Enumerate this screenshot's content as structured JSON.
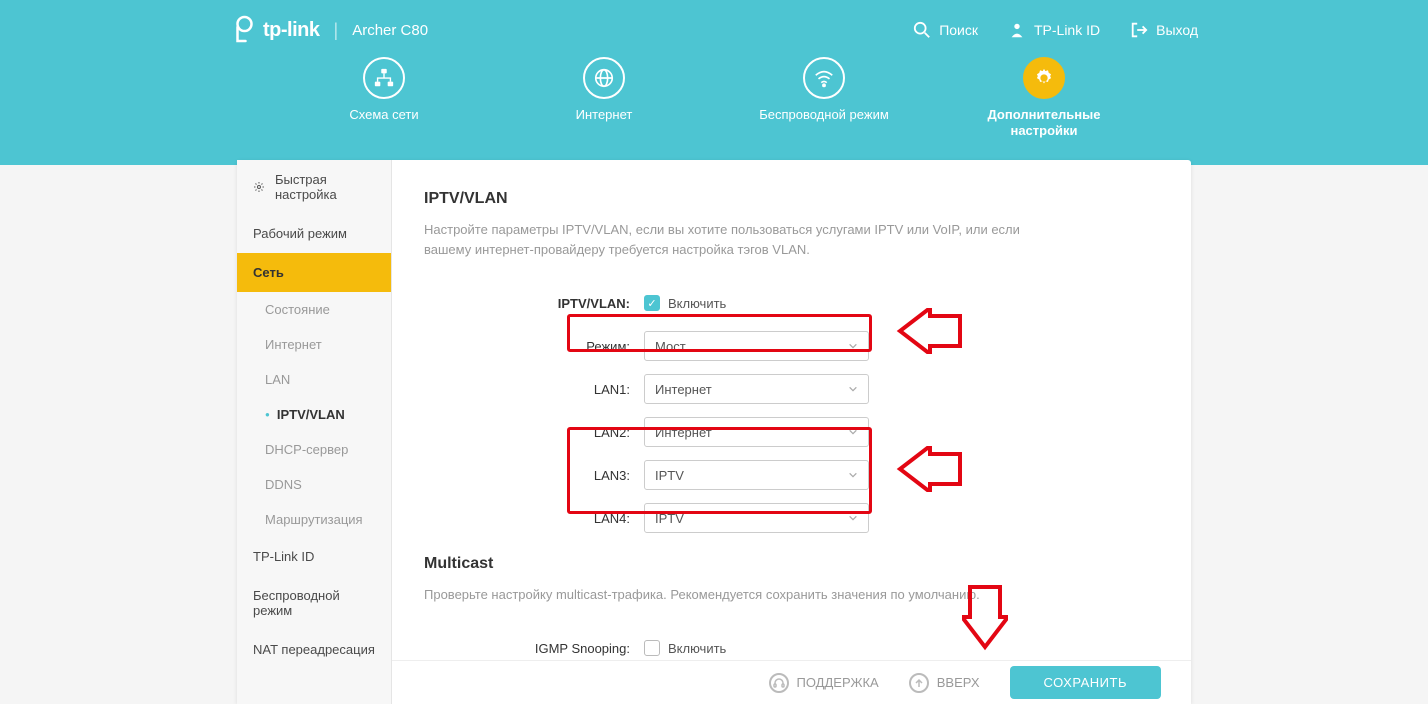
{
  "brand": "tp-link",
  "model": "Archer C80",
  "header_links": {
    "search": "Поиск",
    "tplink_id": "TP-Link ID",
    "logout": "Выход"
  },
  "nav": {
    "network_map": "Схема сети",
    "internet": "Интернет",
    "wireless": "Беспроводной режим",
    "advanced": "Дополнительные настройки"
  },
  "sidebar": {
    "quick_setup": "Быстрая настройка",
    "op_mode": "Рабочий режим",
    "network": "Сеть",
    "status": "Состояние",
    "internet": "Интернет",
    "lan": "LAN",
    "iptv_vlan": "IPTV/VLAN",
    "dhcp": "DHCP-сервер",
    "ddns": "DDNS",
    "routing": "Маршрутизация",
    "tplink_id": "TP-Link ID",
    "wireless": "Беспроводной режим",
    "nat": "NAT переадресация"
  },
  "main": {
    "title": "IPTV/VLAN",
    "desc": "Настройте параметры IPTV/VLAN, если вы хотите пользоваться услугами IPTV или VoIP, или если вашему интернет-провайдеру требуется настройка тэгов VLAN.",
    "labels": {
      "iptv_vlan": "IPTV/VLAN:",
      "mode": "Режим:",
      "lan1": "LAN1:",
      "lan2": "LAN2:",
      "lan3": "LAN3:",
      "lan4": "LAN4:"
    },
    "enable_label": "Включить",
    "iptv_checked": true,
    "mode_value": "Мост",
    "lan1_value": "Интернет",
    "lan2_value": "Интернет",
    "lan3_value": "IPTV",
    "lan4_value": "IPTV",
    "multicast_title": "Multicast",
    "multicast_desc": "Проверьте настройку multicast-трафика. Рекомендуется сохранить значения по умолчанию.",
    "igmp_label": "IGMP Snooping:",
    "igmp_enable": "Включить",
    "igmp_checked": false
  },
  "footer": {
    "support": "ПОДДЕРЖКА",
    "up": "ВВЕРХ",
    "save": "СОХРАНИТЬ"
  }
}
